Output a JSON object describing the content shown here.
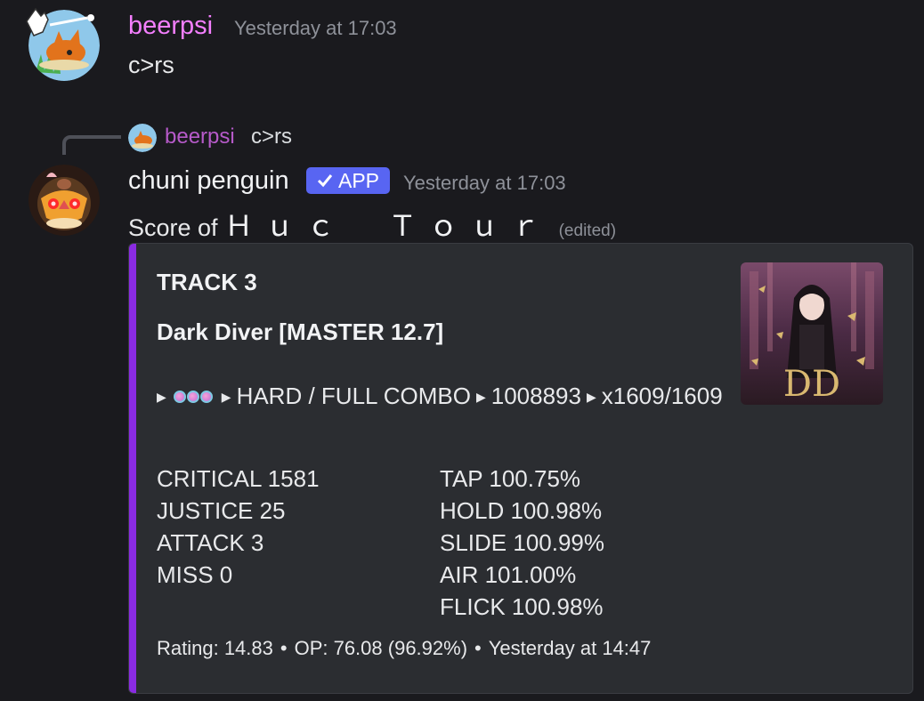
{
  "messages": [
    {
      "username": "beerpsi",
      "username_color": "#f47fff",
      "timestamp": "Yesterday at 17:03",
      "content": "c>rs"
    },
    {
      "reply": {
        "username": "beerpsi",
        "text": "c>rs"
      },
      "username": "chuni penguin",
      "username_color": "#f2f3f5",
      "badge": "APP",
      "timestamp": "Yesterday at 17:03",
      "content_prefix": "Score of",
      "content_name": "Ｈｕｃ　Ｔｏｕｒ",
      "edited": "(edited)",
      "embed": {
        "accent_color": "#8a2be2",
        "title": "TRACK 3",
        "song": "Dark Diver [MASTER 12.7]",
        "result": {
          "lamp": "HARD / FULL COMBO",
          "score": "1008893",
          "combo": "x1609/1609"
        },
        "judgements": [
          "CRITICAL 1581",
          "JUSTICE 25",
          "ATTACK 3",
          "MISS 0"
        ],
        "accuracy": [
          "TAP 100.75%",
          "HOLD 100.98%",
          "SLIDE 100.99%",
          "AIR 101.00%",
          "FLICK 100.98%"
        ],
        "footer": {
          "rating": "Rating: 14.83",
          "op": "OP: 76.08 (96.92%)",
          "time": "Yesterday at 14:47"
        },
        "thumbnail_letters": "DD"
      }
    }
  ]
}
